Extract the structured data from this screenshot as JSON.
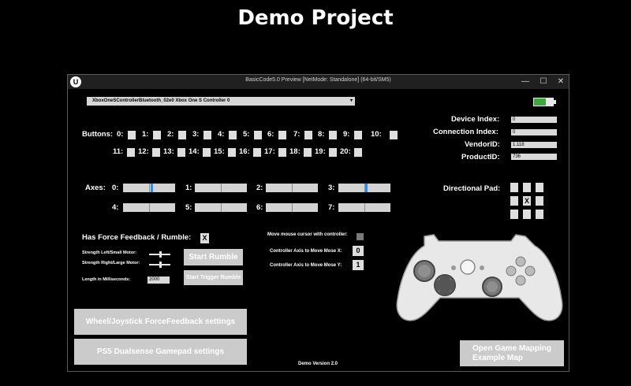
{
  "page_title": "Demo Project",
  "window": {
    "title": "BasicCode5.0 Preview [NetMode: Standalone]  (64-bit/SM5)",
    "controls": {
      "minimize": "—",
      "maximize": "☐",
      "close": "✕"
    }
  },
  "device_select": {
    "value": "XboxOneSControllerBluetooth_02e0 Xbox One S Controller 0"
  },
  "buttons": {
    "label": "Buttons:",
    "row1": [
      "0:",
      "1:",
      "2:",
      "3:",
      "4:",
      "5:",
      "6:",
      "7:",
      "8:",
      "9:",
      "10:"
    ],
    "row2": [
      "11:",
      "12:",
      "13:",
      "14:",
      "15:",
      "16:",
      "17:",
      "18:",
      "19:",
      "20:"
    ]
  },
  "axes": {
    "label": "Axes:",
    "items": [
      {
        "label": "0:",
        "value": 0.1
      },
      {
        "label": "1:",
        "value": 0.0
      },
      {
        "label": "2:",
        "value": 0.0
      },
      {
        "label": "3:",
        "value": 0.05
      },
      {
        "label": "4:",
        "value": 0.0
      },
      {
        "label": "5:",
        "value": 0.0
      },
      {
        "label": "6:",
        "value": 0.0
      },
      {
        "label": "7:",
        "value": 0.0
      }
    ]
  },
  "device_info": {
    "device_index_label": "Device Index:",
    "device_index": "0",
    "connection_index_label": "Connection Index:",
    "connection_index": "0",
    "vendor_label": "VendorID:",
    "vendor": "1.118",
    "product_label": "ProductID:",
    "product": "736"
  },
  "directional_pad": {
    "label": "Directional Pad:",
    "center": "X"
  },
  "force_feedback": {
    "label": "Has Force Feedback / Rumble:",
    "value": "X",
    "left_motor_label": "Strength Left/Small Motor:",
    "right_motor_label": "Strength Right/Large Motor:",
    "length_label": "Length in Milliseconds:",
    "length_value": "2000",
    "start_rumble": "Start Rumble",
    "start_trigger_rumble": "Start Trigger Rumble"
  },
  "mouse": {
    "move_label": "Move mouse cursor with controller:",
    "axis_x_label": "Controller Axis to Move Mose X:",
    "axis_x_value": "0",
    "axis_y_label": "Controller Axis to Move Mose Y:",
    "axis_y_value": "1"
  },
  "bottom": {
    "wheel_button": "Wheel/Joystick ForceFeedback settings",
    "ps5_button": "PS5 Dualsense Gamepad settings",
    "version": "Demo Version 2.0",
    "mapping_button_line1": "Open Game Mapping",
    "mapping_button_line2": "Example Map"
  },
  "colors": {
    "axis_indicator": "#2b8ff0",
    "battery": "#3fa63f"
  },
  "icons": [
    "unreal-logo-icon",
    "battery-icon",
    "gamepad-icon"
  ]
}
